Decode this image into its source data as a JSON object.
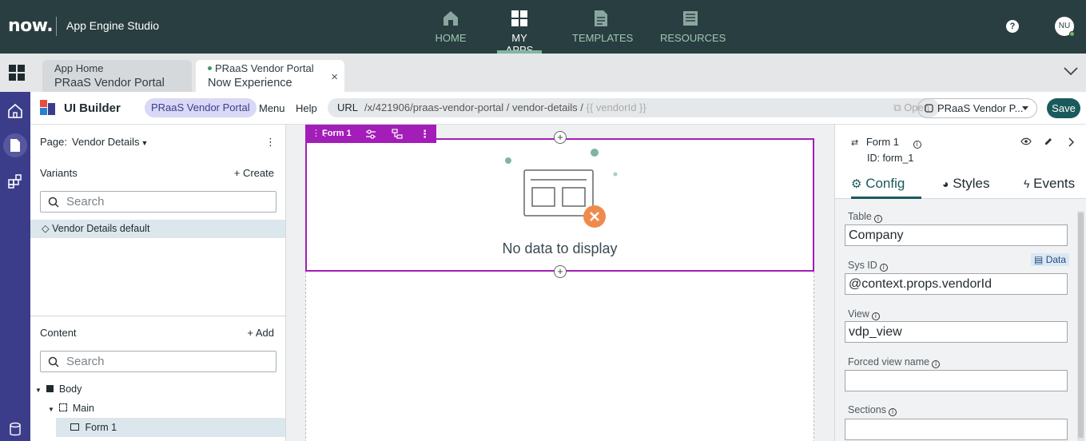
{
  "topnav": {
    "logo": "now.",
    "app_title": "App Engine Studio",
    "items": [
      {
        "label": "HOME",
        "icon": "home-icon"
      },
      {
        "label": "MY APPS",
        "icon": "grid-icon",
        "active": true
      },
      {
        "label": "TEMPLATES",
        "icon": "document-icon"
      },
      {
        "label": "RESOURCES",
        "icon": "book-icon"
      }
    ],
    "help": "?",
    "avatar_initials": "NU"
  },
  "tabs": [
    {
      "line1": "App Home",
      "line2": "PRaaS Vendor Portal"
    },
    {
      "line1": "PRaaS Vendor Portal",
      "line2": "Now Experience",
      "close": "×"
    }
  ],
  "ui_builder": {
    "title": "UI Builder",
    "app_pill": "PRaaS Vendor Portal",
    "menu": "Menu",
    "help": "Help",
    "url_label": "URL",
    "url_path": "/x/421906/praas-vendor-portal / vendor-details /",
    "url_param": "{{ vendorId }}",
    "open_label": "Open",
    "experience_select": "PRaaS Vendor P...",
    "save_label": "Save"
  },
  "left_panel": {
    "page_label": "Page:",
    "page_value": "Vendor Details",
    "variants_heading": "Variants",
    "create_label": "+ Create",
    "variants_search_placeholder": "Search",
    "variants": [
      "Vendor Details default"
    ],
    "content_heading": "Content",
    "add_label": "+ Add",
    "content_search_placeholder": "Search",
    "tree": [
      {
        "label": "Body",
        "level": 0
      },
      {
        "label": "Main",
        "level": 1
      },
      {
        "label": "Form 1",
        "level": 2,
        "selected": true
      }
    ]
  },
  "canvas": {
    "component_label": "Form 1",
    "empty_message": "No data to display"
  },
  "right_panel": {
    "component_name": "Form 1",
    "component_id": "ID: form_1",
    "tabs": [
      {
        "label": "Config",
        "active": true
      },
      {
        "label": "Styles"
      },
      {
        "label": "Events"
      }
    ],
    "data_badge": "Data",
    "fields": [
      {
        "label": "Table",
        "value": "Company"
      },
      {
        "label": "Sys ID",
        "value": "@context.props.vendorId"
      },
      {
        "label": "View",
        "value": "vdp_view"
      },
      {
        "label": "Forced view name",
        "value": ""
      },
      {
        "label": "Sections",
        "value": ""
      }
    ]
  },
  "colors": {
    "topnav_bg": "#293e40",
    "rail_bg": "#3c3d8a",
    "accent_purple": "#a31db8",
    "save_bg": "#1b5a5c",
    "active_nav": "#81b5a1"
  }
}
